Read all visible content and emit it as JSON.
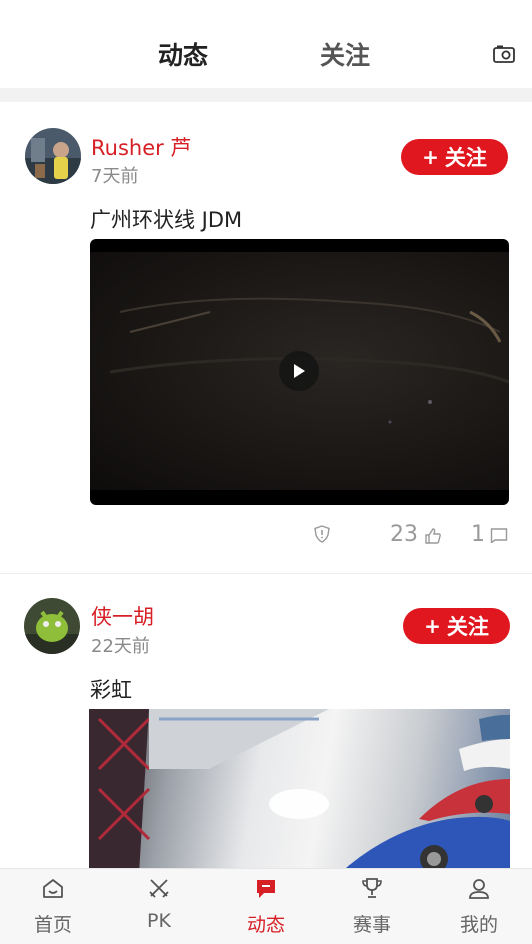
{
  "header": {
    "tabs": [
      {
        "label": "动态",
        "active": true
      },
      {
        "label": "关注",
        "active": false
      }
    ],
    "camera_icon": "camera-icon"
  },
  "posts": [
    {
      "username": "Rusher 芦",
      "time": "7天前",
      "follow_label": "关注",
      "caption": "广州环状线 JDM",
      "media": "video",
      "likes": "23",
      "comments": "1"
    },
    {
      "username": "侠一胡",
      "time": "22天前",
      "follow_label": "关注",
      "caption": "彩虹",
      "media": "image"
    }
  ],
  "bottom_nav": [
    {
      "label": "首页",
      "icon": "home-icon",
      "active": false
    },
    {
      "label": "PK",
      "icon": "crossed-swords-icon",
      "active": false
    },
    {
      "label": "动态",
      "icon": "message-icon",
      "active": true
    },
    {
      "label": "赛事",
      "icon": "trophy-icon",
      "active": false
    },
    {
      "label": "我的",
      "icon": "profile-icon",
      "active": false
    }
  ],
  "colors": {
    "accent": "#e0171f",
    "username": "#d71f26",
    "muted": "#8a8a8a",
    "band": "#f2f2f2"
  }
}
